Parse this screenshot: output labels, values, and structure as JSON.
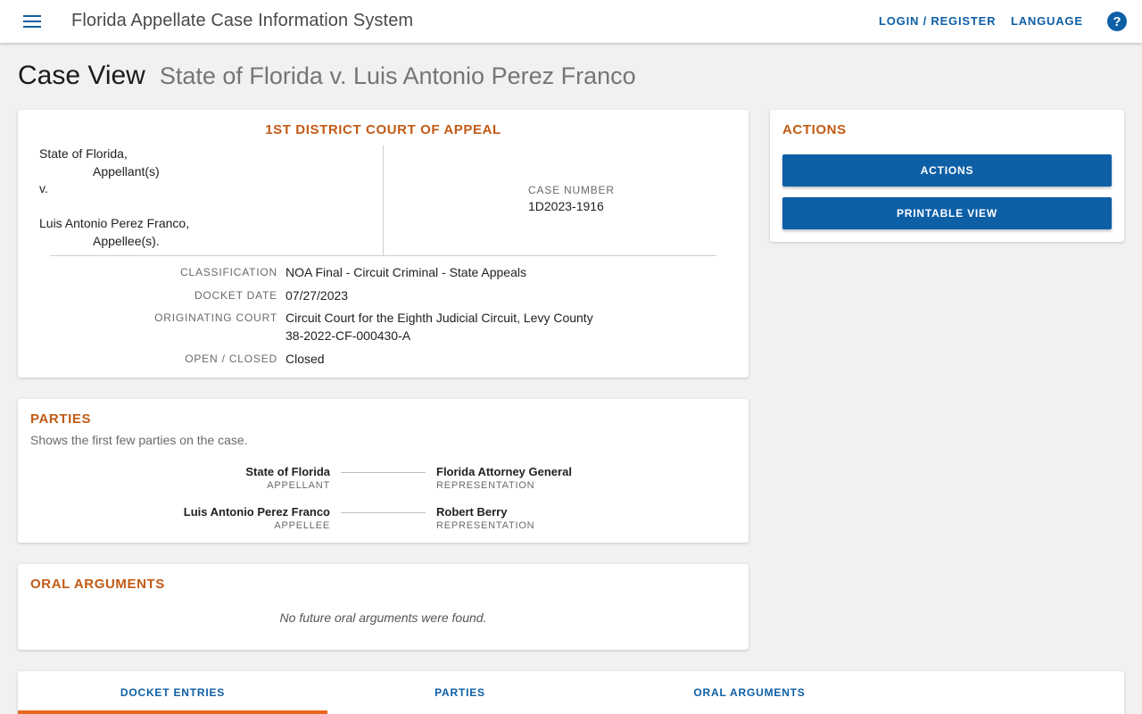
{
  "header": {
    "app_title": "Florida Appellate Case Information System",
    "login_label": "LOGIN / REGISTER",
    "language_label": "LANGUAGE",
    "help_glyph": "?"
  },
  "page": {
    "title": "Case View",
    "subtitle": "State of Florida v. Luis Antonio Perez Franco"
  },
  "case": {
    "court": "1ST DISTRICT COURT OF APPEAL",
    "appellant": "State of Florida,",
    "appellant_role": "Appellant(s)",
    "versus": "v.",
    "appellee": "Luis Antonio Perez Franco,",
    "appellee_role": "Appellee(s).",
    "case_number_label": "CASE NUMBER",
    "case_number": "1D2023-1916",
    "details": [
      {
        "label": "CLASSIFICATION",
        "value": "NOA Final - Circuit Criminal - State Appeals"
      },
      {
        "label": "DOCKET DATE",
        "value": "07/27/2023"
      },
      {
        "label": "ORIGINATING COURT",
        "value": "Circuit Court for the Eighth Judicial Circuit, Levy County",
        "value2": "38-2022-CF-000430-A"
      },
      {
        "label": "OPEN / CLOSED",
        "value": "Closed"
      }
    ]
  },
  "actions": {
    "title": "ACTIONS",
    "actions_button": "ACTIONS",
    "printable_button": "PRINTABLE VIEW"
  },
  "parties": {
    "title": "PARTIES",
    "description": "Shows the first few parties on the case.",
    "rows": [
      {
        "name": "State of Florida",
        "role": "APPELLANT",
        "rep": "Florida Attorney General",
        "rep_role": "REPRESENTATION"
      },
      {
        "name": "Luis Antonio Perez Franco",
        "role": "APPELLEE",
        "rep": "Robert Berry",
        "rep_role": "REPRESENTATION"
      }
    ]
  },
  "oral": {
    "title": "ORAL ARGUMENTS",
    "empty": "No future oral arguments were found."
  },
  "tabs": [
    {
      "label": "DOCKET ENTRIES",
      "active": true
    },
    {
      "label": "PARTIES",
      "active": false
    },
    {
      "label": "ORAL ARGUMENTS",
      "active": false
    }
  ],
  "colors": {
    "primary": "#0d5fa6",
    "accent": "#c25a15",
    "tab_indicator": "#e8681e",
    "background": "#f1f1f1"
  }
}
